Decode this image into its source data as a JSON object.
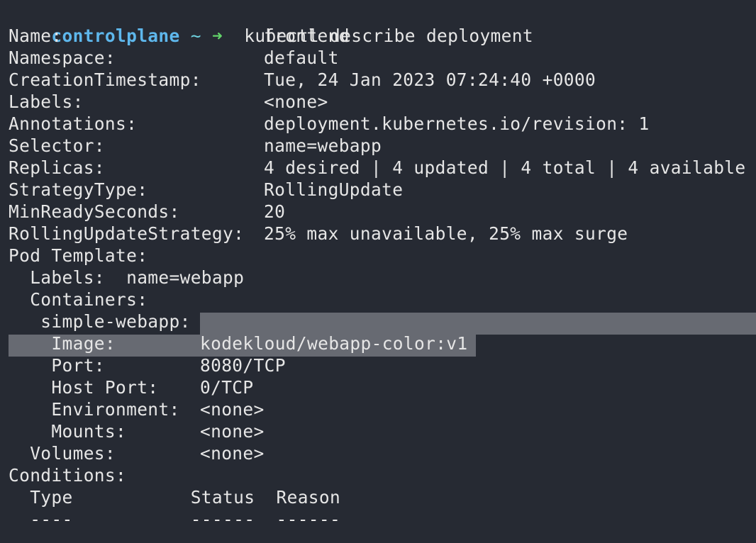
{
  "prompt": {
    "host": "controlplane",
    "path": "~",
    "arrow": "➜",
    "command": "kubectl describe deployment"
  },
  "fields": [
    {
      "key": "Name:",
      "value": "frontend"
    },
    {
      "key": "Namespace:",
      "value": "default"
    },
    {
      "key": "CreationTimestamp:",
      "value": "Tue, 24 Jan 2023 07:24:40 +0000"
    },
    {
      "key": "Labels:",
      "value": "<none>"
    },
    {
      "key": "Annotations:",
      "value": "deployment.kubernetes.io/revision: 1"
    },
    {
      "key": "Selector:",
      "value": "name=webapp"
    },
    {
      "key": "Replicas:",
      "value": "4 desired | 4 updated | 4 total | 4 available"
    },
    {
      "key": "StrategyType:",
      "value": "RollingUpdate"
    },
    {
      "key": "MinReadySeconds:",
      "value": "20"
    },
    {
      "key": "RollingUpdateStrategy:",
      "value": "25% max unavailable, 25% max surge"
    }
  ],
  "pod_template": {
    "heading": "Pod Template:",
    "labels_line": "  Labels:  name=webapp",
    "containers_heading": "  Containers:",
    "container_name": "   simple-webapp:",
    "container_fields": [
      {
        "key": "    Image:",
        "value": "kodekloud/webapp-color:v1"
      },
      {
        "key": "    Port:",
        "value": "8080/TCP"
      },
      {
        "key": "    Host Port:",
        "value": "0/TCP"
      },
      {
        "key": "    Environment:",
        "value": "<none>"
      },
      {
        "key": "    Mounts:",
        "value": "<none>"
      }
    ],
    "volumes": {
      "key": "  Volumes:",
      "value": "<none>"
    }
  },
  "conditions": {
    "heading": "Conditions:",
    "header_line": "  Type           Status  Reason",
    "underline_line": "  ----           ------  ------"
  },
  "colors": {
    "background": "#262a33",
    "text": "#e6e6e6",
    "prompt_host": "#5eb7ec",
    "prompt_arrow": "#63d36a",
    "selection": "#676a72"
  }
}
